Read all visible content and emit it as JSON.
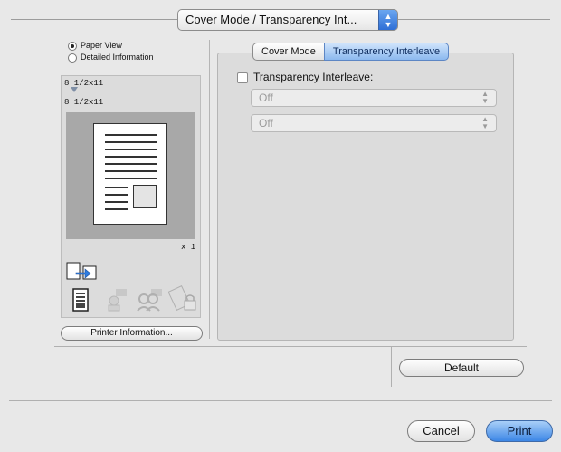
{
  "header": {
    "mode_popup_label": "Cover Mode / Transparency Int..."
  },
  "preview": {
    "view_options": [
      {
        "label": "Paper View",
        "selected": true
      },
      {
        "label": "Detailed Information",
        "selected": false
      }
    ],
    "source_size": "8 1/2x11",
    "output_size": "8 1/2x11",
    "copies_label": "x 1",
    "printer_info_button": "Printer Information..."
  },
  "tabs": [
    {
      "label": "Cover Mode",
      "active": false
    },
    {
      "label": "Transparency Interleave",
      "active": true
    }
  ],
  "transparency": {
    "checkbox_label": "Transparency Interleave:",
    "checked": false,
    "select_1_value": "Off",
    "select_2_value": "Off"
  },
  "buttons": {
    "default": "Default",
    "cancel": "Cancel",
    "print": "Print"
  },
  "colors": {
    "accent": "#3c86e6",
    "window_bg": "#e8e8e8"
  }
}
